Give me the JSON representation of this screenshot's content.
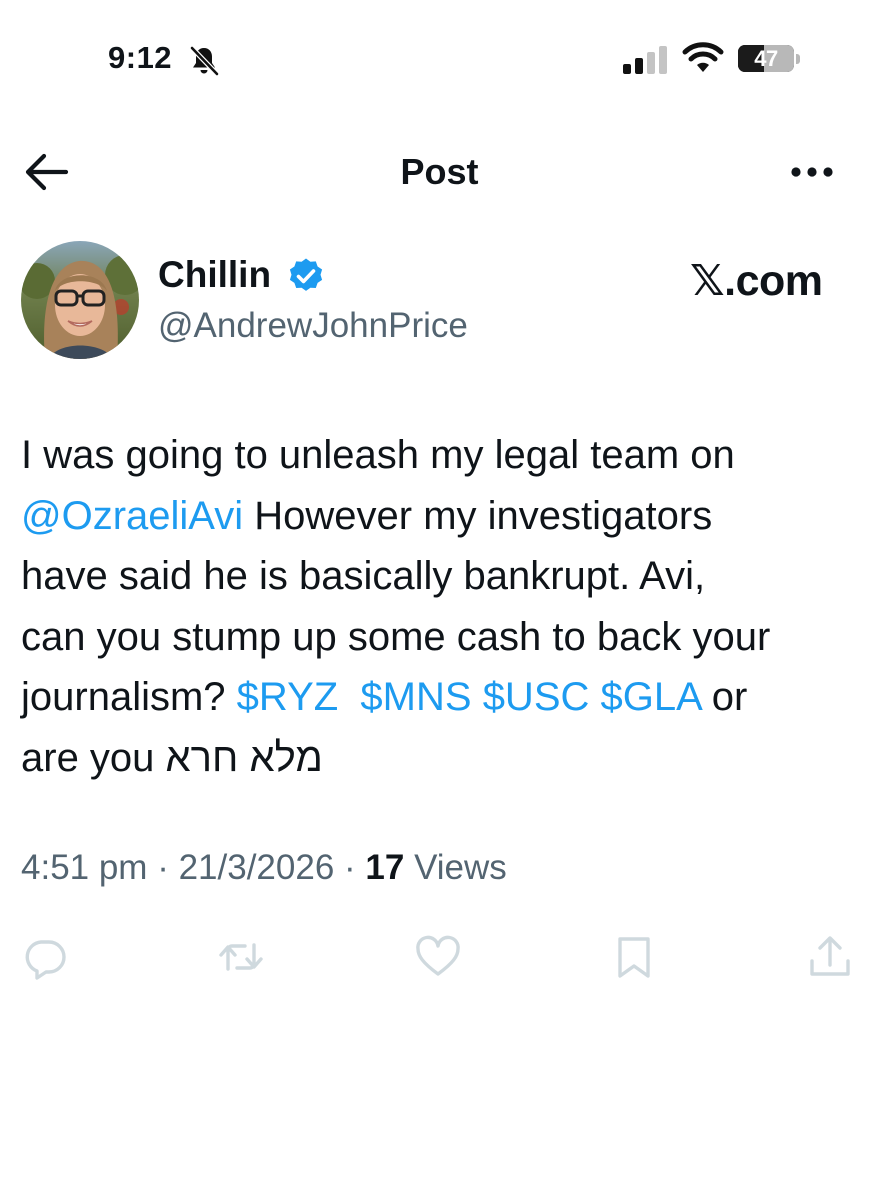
{
  "status_bar": {
    "time": "9:12",
    "battery": "47",
    "battery_level": 0.47,
    "silent_icon": "bell-slash-icon",
    "signal_icon": "cellular-signal-icon",
    "wifi_icon": "wifi-icon"
  },
  "nav": {
    "title": "Post",
    "back_icon": "arrow-left-icon",
    "more_icon": "more-horizontal-icon"
  },
  "author": {
    "display_name": "Chillin",
    "handle": "@AndrewJohnPrice",
    "verified": true,
    "verified_color": "#1d9bf0"
  },
  "watermark": {
    "x": "𝕏",
    "domain": ".com"
  },
  "tweet": {
    "line1": "I was going to unleash my legal team on",
    "mention": "@OzraeliAvi",
    "line2_rest": " However my investigators",
    "line3": "have said he is basically bankrupt. Avi,",
    "line4": "can you stump up some cash to back your",
    "line5_start": "journalism? ",
    "cashtag1": "$RYZ",
    "cashtag2": "$MNS",
    "cashtag3": "$USC",
    "cashtag4": "$GLA",
    "line5_end": " or",
    "line6_start": "are you ",
    "hebrew": "מלא חרא"
  },
  "meta": {
    "time": "4:51 pm",
    "separator": " · ",
    "date": "21/3/2026",
    "views_count": "17",
    "views_label": " Views"
  },
  "actions": [
    {
      "name": "reply",
      "icon": "reply-icon"
    },
    {
      "name": "repost",
      "icon": "repost-icon"
    },
    {
      "name": "like",
      "icon": "heart-icon"
    },
    {
      "name": "bookmark",
      "icon": "bookmark-icon"
    },
    {
      "name": "share",
      "icon": "share-icon"
    }
  ],
  "colors": {
    "link": "#1d9bf0",
    "secondary_text": "#536471",
    "primary_text": "#0f1419",
    "action_icon": "#cfd9de"
  }
}
